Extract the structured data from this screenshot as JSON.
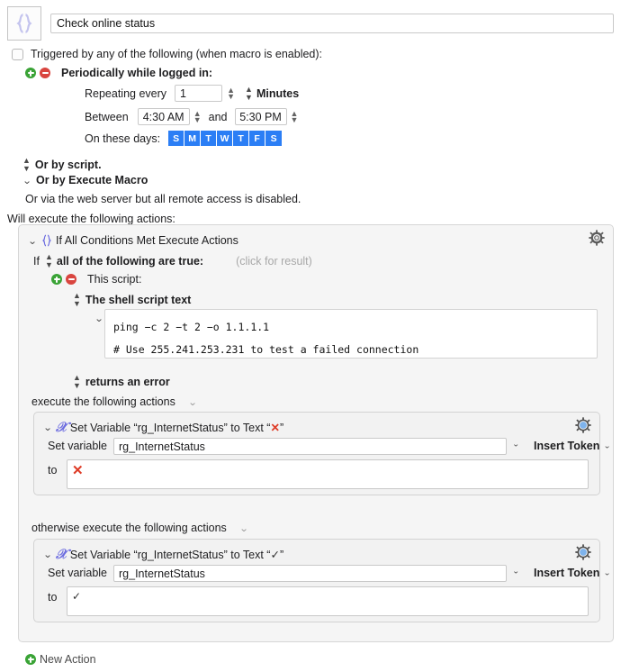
{
  "macro": {
    "icon_name": "curly-braces-icon",
    "name": "Check online status"
  },
  "triggers": {
    "checkbox_label": "Triggered by any of the following (when macro is enabled):",
    "checkbox_checked": false,
    "periodic": {
      "title": "Periodically while logged in:",
      "repeating_label": "Repeating every",
      "repeating_value": "1",
      "unit": "Minutes",
      "between_label": "Between",
      "start_time": "4:30 AM",
      "and_label": "and",
      "end_time": "5:30 PM",
      "days_label": "On these days:",
      "days": [
        {
          "letter": "S",
          "selected": true
        },
        {
          "letter": "M",
          "selected": true
        },
        {
          "letter": "T",
          "selected": true
        },
        {
          "letter": "W",
          "selected": true
        },
        {
          "letter": "T",
          "selected": true
        },
        {
          "letter": "F",
          "selected": true
        },
        {
          "letter": "S",
          "selected": true
        }
      ]
    },
    "or_by_script": "Or by script.",
    "or_by_execute_macro": "Or by Execute Macro",
    "web_server_note": "Or via the web server but all remote access is disabled."
  },
  "will_execute_label": "Will execute the following actions:",
  "if_action": {
    "title": "If All Conditions Met Execute Actions",
    "icon_name": "curly-braces-icon",
    "gear_name": "action-gear-icon",
    "condition_prefix": "If",
    "condition_mode": "all of the following are true:",
    "click_for_result": "(click for result)",
    "script_condition": {
      "title": "This script:",
      "source": "The shell script text",
      "script_lines": [
        "ping −c 2 −t 2 −o 1.1.1.1",
        "# Use 255.241.253.231 to test a failed connection"
      ],
      "result_test": "returns an error"
    },
    "then_label": "execute the following actions",
    "else_label": "otherwise execute the following actions",
    "then_action": {
      "title": "Set Variable “rg_InternetStatus” to Text “❌”",
      "title_pre": "Set Variable “rg_InternetStatus” to Text “",
      "title_glyph": "✕",
      "title_post": "”",
      "icon_name": "variable-x-icon",
      "set_variable_label": "Set variable",
      "variable_name": "rg_InternetStatus",
      "insert_token_label": "Insert Token",
      "to_label": "to",
      "to_value": "✕"
    },
    "else_action": {
      "title_pre": "Set Variable “rg_InternetStatus” to Text “",
      "title_glyph": "✓",
      "title_post": "”",
      "icon_name": "variable-x-icon",
      "set_variable_label": "Set variable",
      "variable_name": "rg_InternetStatus",
      "insert_token_label": "Insert Token",
      "to_label": "to",
      "to_value": "✓"
    }
  },
  "new_action_label": "New Action",
  "colors": {
    "day_selected": "#2b7ef5",
    "add_green": "#3aa336",
    "remove_red": "#d9453f",
    "variable_icon": "#6d6de0",
    "red_x": "#de3b26",
    "panel_bg": "#f5f5f5"
  }
}
